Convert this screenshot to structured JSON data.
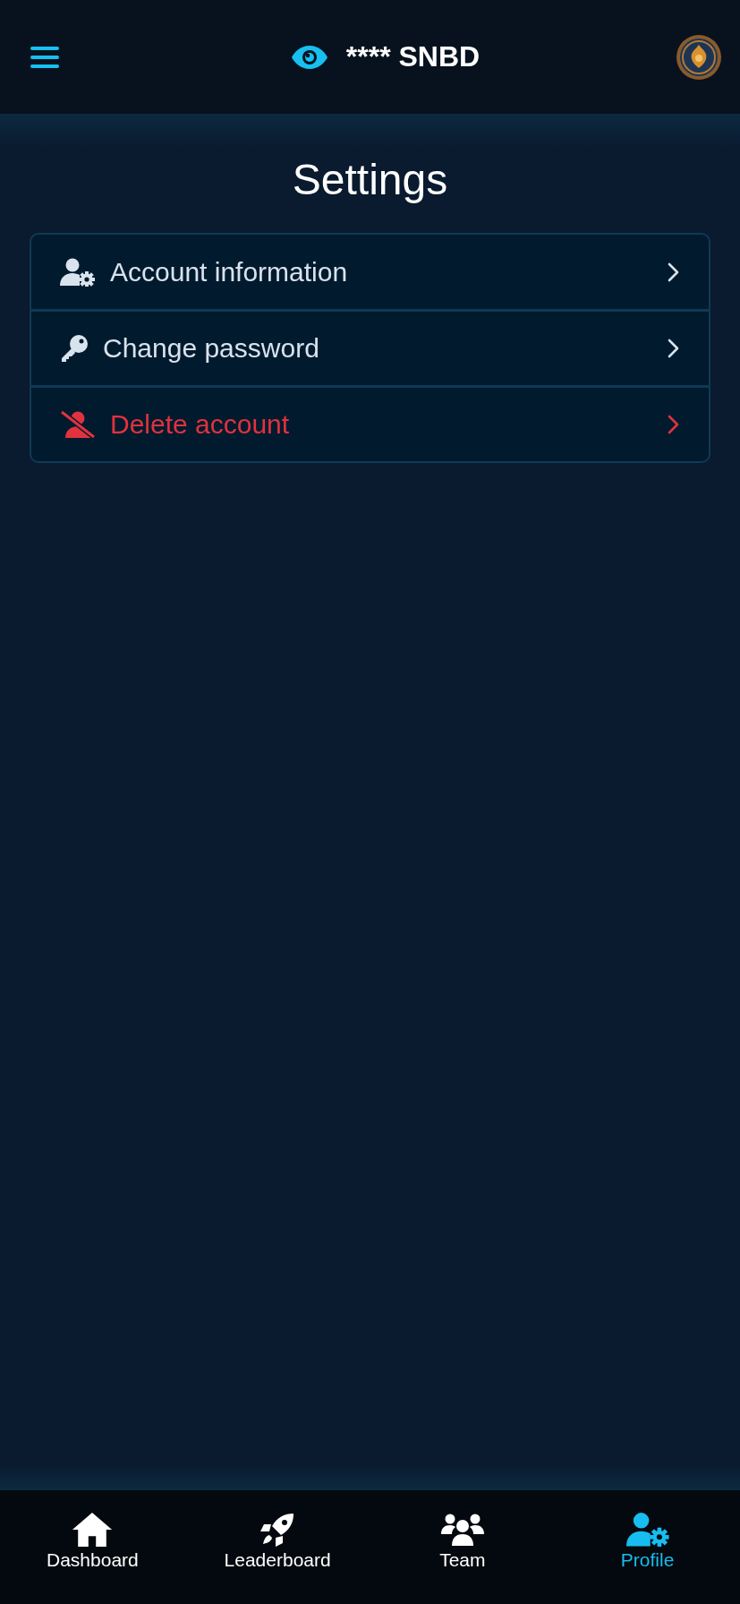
{
  "header": {
    "balance": "**** SNBD"
  },
  "title": "Settings",
  "settings": [
    {
      "kind": "account",
      "label": "Account information"
    },
    {
      "kind": "password",
      "label": "Change password"
    },
    {
      "kind": "delete",
      "label": "Delete account"
    }
  ],
  "nav": [
    {
      "kind": "home",
      "label": "Dashboard",
      "selected": false
    },
    {
      "kind": "rocket",
      "label": "Leaderboard",
      "selected": false
    },
    {
      "kind": "team",
      "label": "Team",
      "selected": false
    },
    {
      "kind": "profile",
      "label": "Profile",
      "selected": true
    }
  ]
}
